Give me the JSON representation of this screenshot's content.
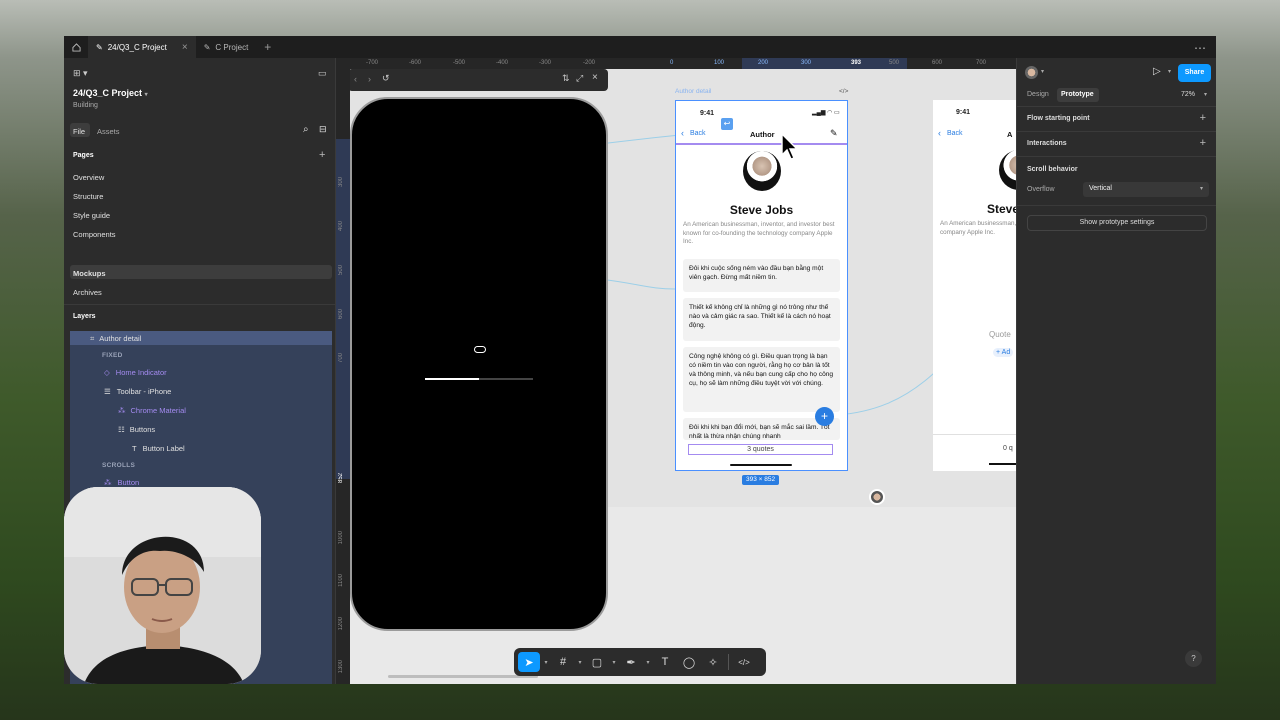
{
  "tabs": [
    {
      "label": "24/Q3_C Project",
      "active": true
    },
    {
      "label": "C Project",
      "active": false
    }
  ],
  "left": {
    "project_name": "24/Q3_C Project",
    "project_status": "Building",
    "file_tab": "File",
    "assets_tab": "Assets",
    "pages_header": "Pages",
    "pages": [
      "Overview",
      "Structure",
      "Style guide",
      "Components",
      "Mockups",
      "Archives"
    ],
    "layers_header": "Layers",
    "layers": {
      "root": "Author detail",
      "fixed_label": "FIXED",
      "home_indicator": "Home Indicator",
      "toolbar": "Toolbar - iPhone",
      "chrome_material": "Chrome Material",
      "buttons": "Buttons",
      "button_label": "Button Label",
      "scrolls_label": "SCROLLS",
      "button": "Button"
    }
  },
  "rulers": {
    "top": [
      "-700",
      "-600",
      "-500",
      "-400",
      "-300",
      "-200",
      "0",
      "100",
      "200",
      "300",
      "393",
      "500",
      "600",
      "700"
    ],
    "left": [
      "300",
      "400",
      "500",
      "600",
      "700",
      "852",
      "1000",
      "1100",
      "1200",
      "1300"
    ]
  },
  "frame": {
    "label": "Author detail",
    "code_icon": "</>",
    "time": "9:41",
    "back": "Back",
    "nav_title": "Author",
    "author_name": "Steve Jobs",
    "bio": "An American businessman, inventor, and investor best known for co-founding the technology company Apple Inc.",
    "quotes": [
      "Đôi khi cuộc sống ném vào đầu bạn bằng một viên gạch. Đừng mất niềm tin.",
      "Thiết kế không chỉ là những gì nó trông như thế nào và cảm giác ra sao. Thiết kế là cách nó hoạt động.",
      "Công nghệ không có gì. Điều quan trọng là bạn có niềm tin vào con người, rằng họ cơ bản là tốt và thông minh, và nếu bạn cung cấp cho họ công cụ, họ sẽ làm những điều tuyệt vời với chúng.",
      "Đôi khi khi bạn đổi mới, bạn sẽ mắc sai lầm. Tốt nhất là thừa nhận chúng nhanh"
    ],
    "footer": "3 quotes",
    "size_badge": "393 × 852"
  },
  "frame2": {
    "time": "9:41",
    "back": "Back",
    "name_partial": "Steve",
    "bio": "An American businessman, best known for co-foundi company Apple Inc.",
    "quote_partial": "Quote",
    "add_partial": "+ Ad",
    "footer_partial": "0 q"
  },
  "right": {
    "design_tab": "Design",
    "prototype_tab": "Prototype",
    "zoom": "72%",
    "share": "Share",
    "flow_starting_point": "Flow starting point",
    "interactions": "Interactions",
    "scroll_behavior": "Scroll behavior",
    "overflow_label": "Overflow",
    "overflow_value": "Vertical",
    "show_settings": "Show prototype settings"
  },
  "toolbar": {
    "code": "</>"
  },
  "help": "?",
  "colors": {
    "accent": "#0d99ff",
    "selection": "#4a90ff",
    "panel": "#2c2c2c",
    "purple": "#a48bf0"
  }
}
